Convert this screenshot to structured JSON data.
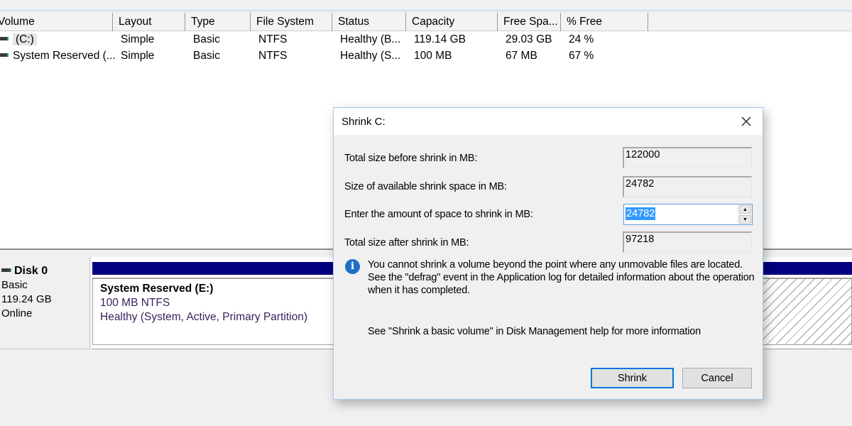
{
  "volume_list": {
    "columns": [
      "Volume",
      "Layout",
      "Type",
      "File System",
      "Status",
      "Capacity",
      "Free Spa...",
      "% Free"
    ],
    "rows": [
      {
        "volume": "(C:)",
        "layout": "Simple",
        "type": "Basic",
        "fs": "NTFS",
        "status": "Healthy (B...",
        "capacity": "119.14 GB",
        "free": "29.03 GB",
        "pct_free": "24 %",
        "icon": "drive-icon"
      },
      {
        "volume": "System Reserved (...",
        "layout": "Simple",
        "type": "Basic",
        "fs": "NTFS",
        "status": "Healthy (S...",
        "capacity": "100 MB",
        "free": "67 MB",
        "pct_free": "67 %",
        "icon": "drive-icon"
      }
    ]
  },
  "disk": {
    "name": "Disk 0",
    "type": "Basic",
    "size": "119.24 GB",
    "state": "Online",
    "partition_bar_color": "#000080",
    "partitions": [
      {
        "name": "System Reserved  (E:)",
        "size_fs": "100 MB NTFS",
        "status": "Healthy (System, Active, Primary Partition)"
      }
    ]
  },
  "dialog": {
    "title": "Shrink C:",
    "fields": [
      {
        "label": "Total size before shrink in MB:",
        "value": "122000"
      },
      {
        "label": "Size of available shrink space in MB:",
        "value": "24782"
      },
      {
        "label": "Enter the amount of space to shrink in MB:",
        "value": "24782"
      },
      {
        "label": "Total size after shrink in MB:",
        "value": "97218"
      }
    ],
    "info_text": "You cannot shrink a volume beyond the point where any unmovable files are located. See the \"defrag\" event in the Application log for detailed information about the operation when it has completed.",
    "help_text": "See \"Shrink a basic volume\" in Disk Management help for more information",
    "shrink_label": "Shrink",
    "cancel_label": "Cancel",
    "accent_color": "#0078d7"
  }
}
